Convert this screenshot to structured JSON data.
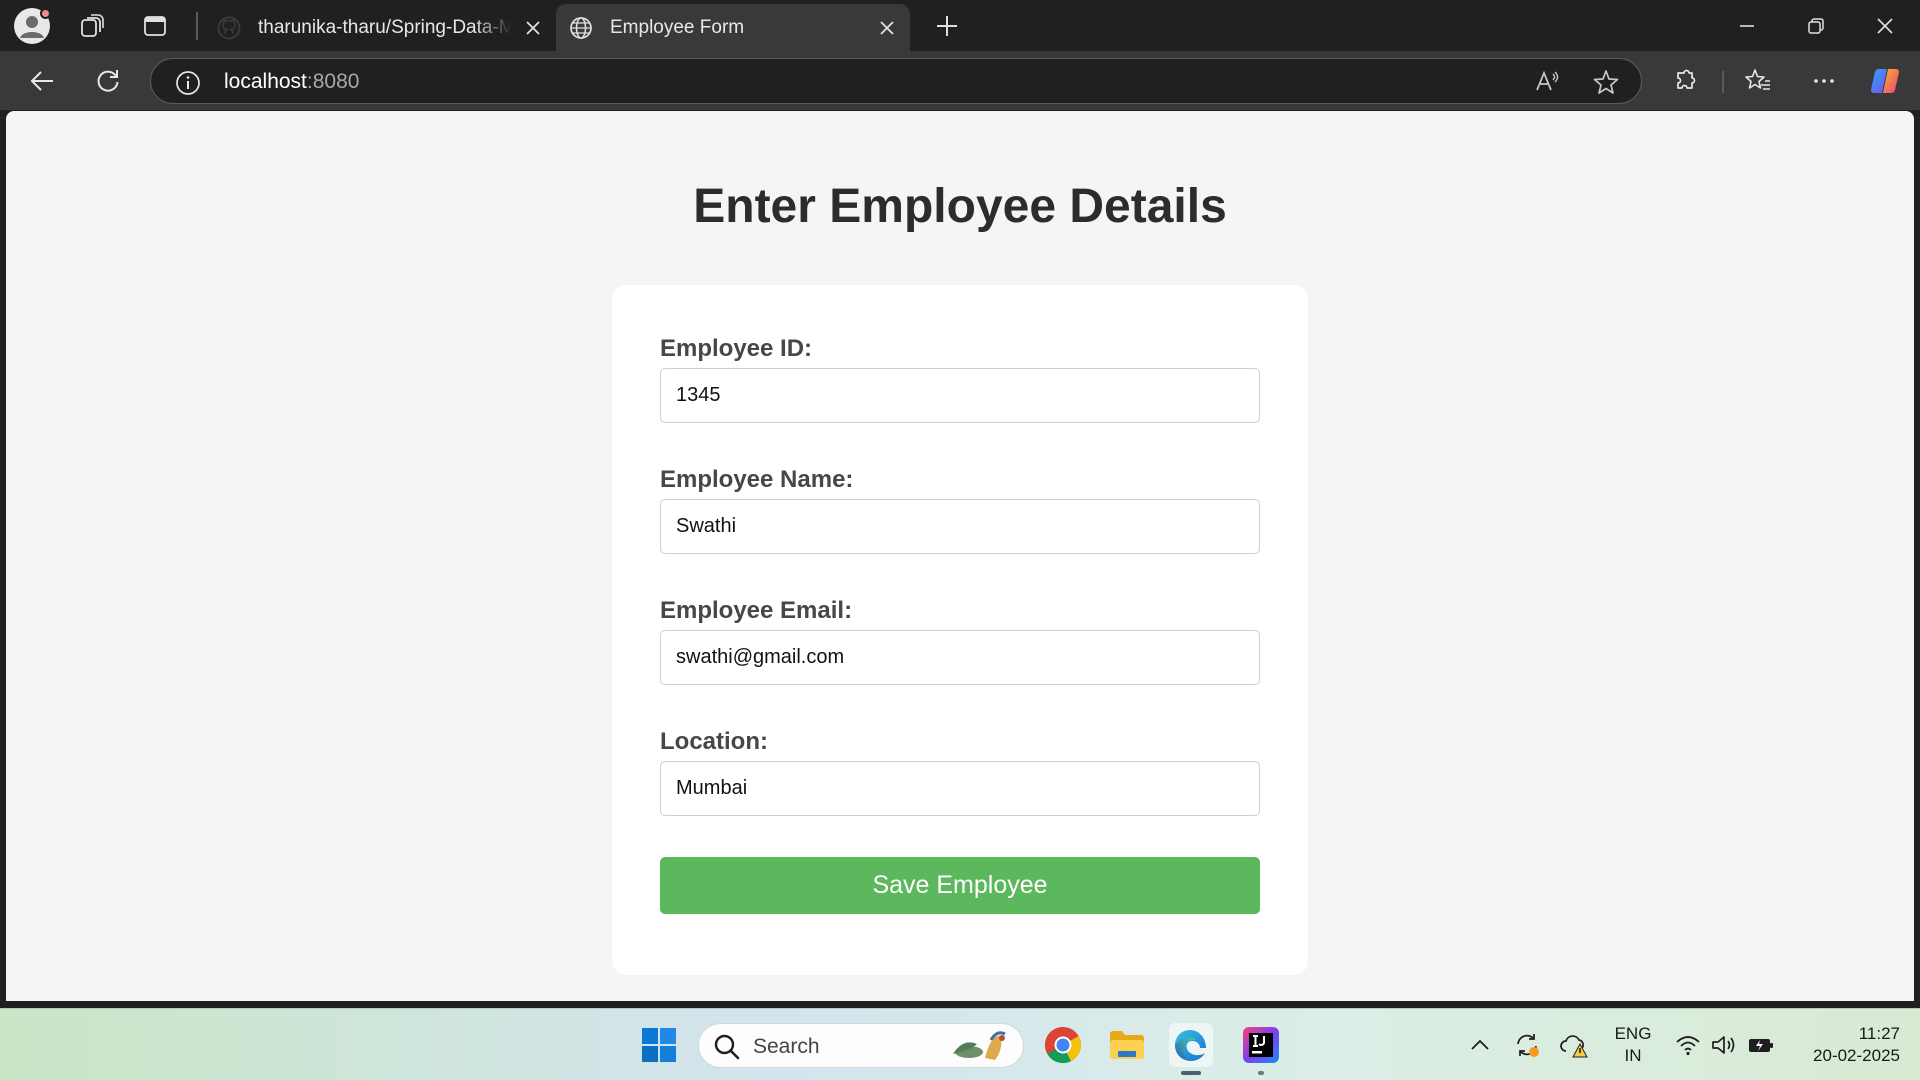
{
  "browser": {
    "tabs": [
      {
        "title": "tharunika-tharu/Spring-Data-Mongo",
        "favicon": "github-icon",
        "active": false
      },
      {
        "title": "Employee Form",
        "favicon": "globe-icon",
        "active": true
      }
    ],
    "address_bar": {
      "host": "localhost",
      "port": ":8080"
    }
  },
  "page": {
    "heading": "Enter Employee Details",
    "form": {
      "fields": [
        {
          "label": "Employee ID:",
          "value": "1345"
        },
        {
          "label": "Employee Name:",
          "value": "Swathi"
        },
        {
          "label": "Employee Email:",
          "value": "swathi@gmail.com"
        },
        {
          "label": "Location:",
          "value": "Mumbai"
        }
      ],
      "submit_label": "Save Employee",
      "submit_color": "#5cb85c"
    }
  },
  "taskbar": {
    "search_label": "Search",
    "pinned": [
      "windows-start-icon",
      "chrome-icon",
      "file-explorer-icon",
      "edge-icon",
      "intellij-icon"
    ],
    "tray": {
      "language": "ENG",
      "region": "IN",
      "time": "11:27",
      "date": "20-02-2025"
    }
  }
}
